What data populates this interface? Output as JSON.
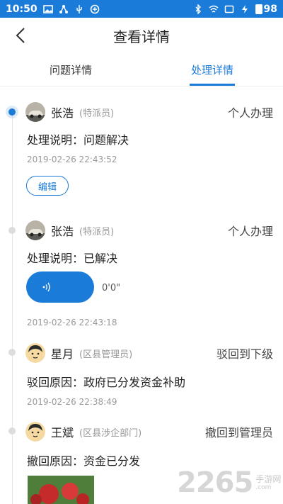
{
  "status_bar": {
    "time": "10:50",
    "battery_level": "98",
    "left_icons": [
      "image-icon",
      "share-icon",
      "usb-icon",
      "vpn-icon"
    ],
    "right_icons": [
      "bluetooth-icon",
      "wifi-icon",
      "screen-icon",
      "charging-icon",
      "battery-icon"
    ],
    "color": "#1a7bd8"
  },
  "header": {
    "title": "查看详情",
    "back_icon": "chevron-left-icon"
  },
  "tabs": [
    {
      "label": "问题详情",
      "active": false
    },
    {
      "label": "处理详情",
      "active": true
    }
  ],
  "accent_color": "#1a7bd8",
  "records": [
    {
      "name": "张浩",
      "role": "(特派员)",
      "action": "个人办理",
      "desc": "处理说明：问题解决",
      "time": "2019-02-26 22:43:52",
      "edit_label": "编辑",
      "avatar": "car-avatar",
      "active": true
    },
    {
      "name": "张浩",
      "role": "(特派员)",
      "action": "个人办理",
      "desc": "处理说明：已解决",
      "voice_duration": "0'0\"",
      "time": "2019-02-26 22:43:18",
      "avatar": "car-avatar",
      "active": false
    },
    {
      "name": "星月",
      "role": "(区县管理员)",
      "action": "驳回到下级",
      "desc": "驳回原因：政府已分发资金补助",
      "time": "2019-02-26 22:38:49",
      "avatar": "person-avatar",
      "active": false
    },
    {
      "name": "王斌",
      "role": "(区县涉企部门)",
      "action": "撤回到管理员",
      "desc": "撤回原因：资金已分发",
      "avatar": "person-avatar",
      "active": false
    }
  ],
  "watermark": {
    "big": "2265",
    "cn": "手游网",
    "en": ".com"
  }
}
